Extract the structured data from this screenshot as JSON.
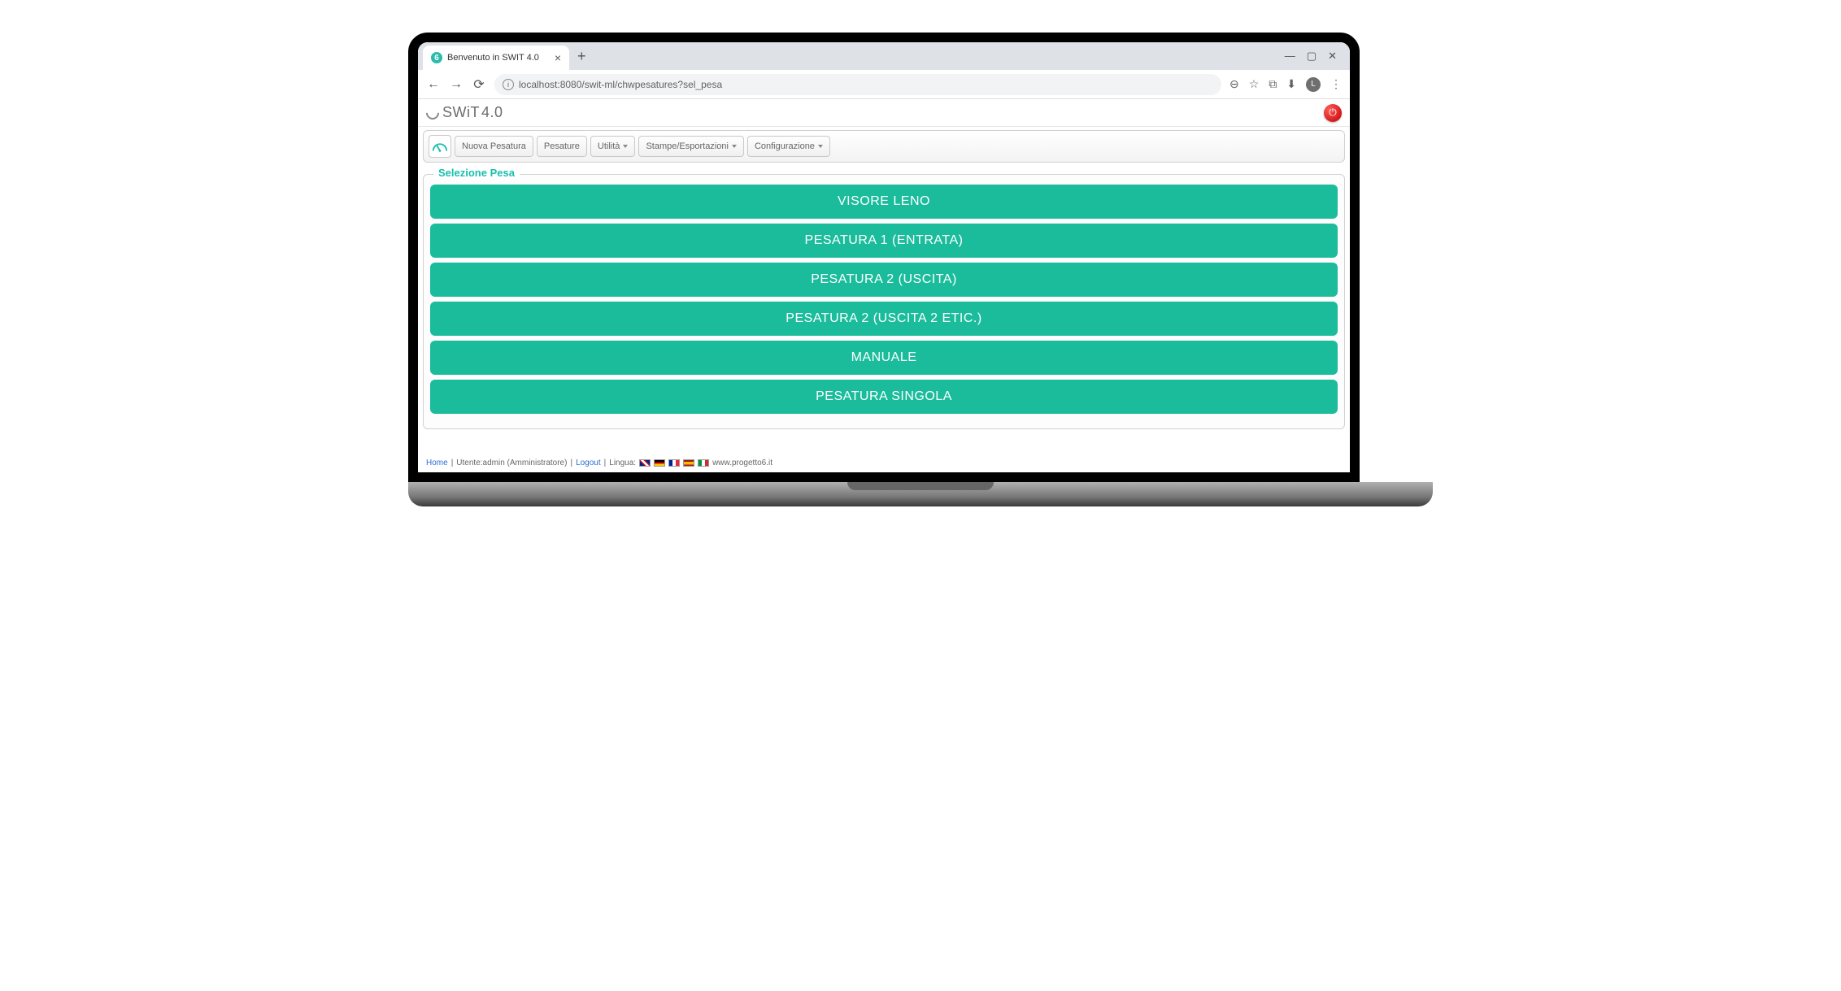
{
  "browser": {
    "tab_title": "Benvenuto in SWIT 4.0",
    "url": "localhost:8080/swit-ml/chwpesatures?sel_pesa",
    "favicon_char": "6",
    "avatar_char": "L"
  },
  "app": {
    "logo_main": "SWiT",
    "logo_version": "4.0"
  },
  "nav": {
    "items": [
      {
        "label": "Nuova Pesatura",
        "has_caret": false
      },
      {
        "label": "Pesature",
        "has_caret": false
      },
      {
        "label": "Utilità",
        "has_caret": true
      },
      {
        "label": "Stampe/Esportazioni",
        "has_caret": true
      },
      {
        "label": "Configurazione",
        "has_caret": true
      }
    ]
  },
  "panel": {
    "title": "Selezione Pesa",
    "buttons": [
      "VISORE LENO",
      "PESATURA 1 (ENTRATA)",
      "PESATURA 2 (USCITA)",
      "PESATURA 2 (USCITA 2 ETIC.)",
      "MANUALE",
      "PESATURA SINGOLA"
    ]
  },
  "footer": {
    "home": "Home",
    "user_label": "Utente:admin (Amministratore)",
    "logout": "Logout",
    "lang_label": "Lingua:",
    "site": "www.progetto6.it"
  }
}
